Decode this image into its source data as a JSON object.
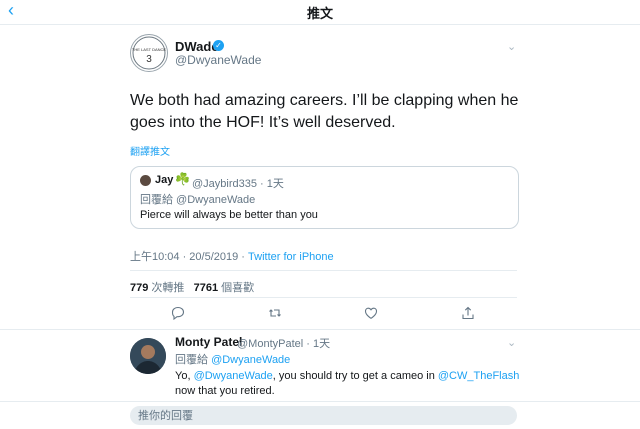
{
  "nav": {
    "back_icon": "chevron-left-icon",
    "title": "推文"
  },
  "tweet": {
    "avatar_text": "THE LAST DANCE",
    "name": "DWade",
    "verified_icon": "verified-badge-icon",
    "handle": "@DwyaneWade",
    "text": "We both had amazing careers. I’ll be clapping when he goes into the HOF! It’s well deserved.",
    "translate_label": "翻譯推文",
    "timestamp": "上午10:04 · 20/5/2019 ·",
    "source": "Twitter for iPhone",
    "retweets": "779",
    "retweets_label": "次轉推",
    "likes": "7761",
    "likes_label": "個喜歡"
  },
  "quoted": {
    "name": "Jay",
    "emoji": "☘️",
    "handle": "@Jaybird335 · 1天",
    "reply_to": "回覆給 @DwyaneWade",
    "text": "Pierce will always be better than you"
  },
  "actions": [
    "reply-icon",
    "retweet-icon",
    "like-icon",
    "share-icon"
  ],
  "reply": {
    "name": "Monty Patel",
    "handle": "@MontyPatel · 1天",
    "reply_to_label": "回覆給",
    "reply_to_handle": "@DwyaneWade",
    "text_1": "Yo, ",
    "mention_1": "@DwyaneWade",
    "text_2": ", you should try to get a cameo in ",
    "mention_2": "@CW_TheFlash",
    "text_3": " now that you retired."
  },
  "composer": {
    "placeholder": "推你的回覆"
  },
  "colors": {
    "accent": "#1da1f2",
    "secondary_text": "#657786",
    "divider": "#e6ecf0"
  }
}
